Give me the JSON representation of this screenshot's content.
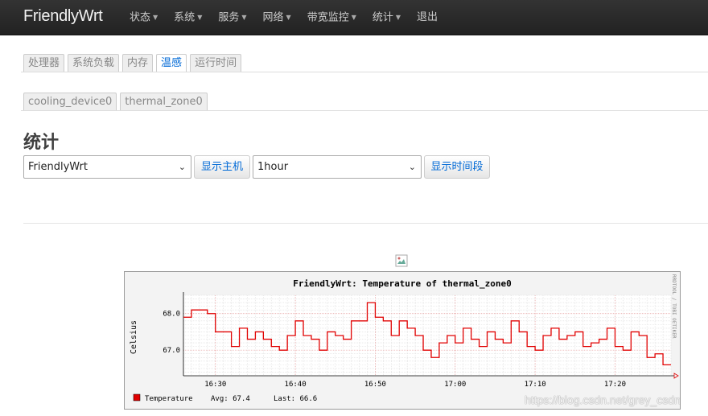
{
  "navbar": {
    "brand": "FriendlyWrt",
    "menu": [
      {
        "label": "状态",
        "dropdown": true
      },
      {
        "label": "系统",
        "dropdown": true
      },
      {
        "label": "服务",
        "dropdown": true
      },
      {
        "label": "网络",
        "dropdown": true
      },
      {
        "label": "带宽监控",
        "dropdown": true
      },
      {
        "label": "统计",
        "dropdown": true
      },
      {
        "label": "退出",
        "dropdown": false
      }
    ]
  },
  "tabs_primary": [
    {
      "label": "处理器",
      "active": false
    },
    {
      "label": "系统负载",
      "active": false
    },
    {
      "label": "内存",
      "active": false
    },
    {
      "label": "温感",
      "active": true
    },
    {
      "label": "运行时间",
      "active": false
    }
  ],
  "tabs_secondary": [
    {
      "label": "cooling_device0",
      "active": false
    },
    {
      "label": "thermal_zone0",
      "active": false
    }
  ],
  "page_title": "统计",
  "controls": {
    "host_select": "FriendlyWrt",
    "host_button": "显示主机",
    "timespan_select": "1hour",
    "timespan_button": "显示时间段"
  },
  "graph": {
    "title": "FriendlyWrt: Temperature of thermal_zone0",
    "ylabel": "Celsius",
    "side_text": "RRDTOOL / TOBI OETIKER",
    "legend": {
      "name": "Temperature",
      "avg": "Avg: 67.4",
      "last": "Last: 66.6",
      "color": "#e00000"
    }
  },
  "watermark": "https://blog.csdn.net/grey_csdn",
  "chart_data": {
    "type": "line",
    "title": "FriendlyWrt: Temperature of thermal_zone0",
    "xlabel": "",
    "ylabel": "Celsius",
    "x_ticks": [
      "16:30",
      "16:40",
      "16:50",
      "17:00",
      "17:10",
      "17:20"
    ],
    "y_ticks": [
      67.0,
      68.0
    ],
    "ylim": [
      66.3,
      68.5
    ],
    "grid": true,
    "series": [
      {
        "name": "Temperature",
        "color": "#e00000",
        "x_minutes_from_1630": [
          -4,
          -3,
          -2,
          -1,
          0,
          1,
          2,
          3,
          4,
          5,
          6,
          7,
          8,
          9,
          10,
          11,
          12,
          13,
          14,
          15,
          16,
          17,
          18,
          19,
          20,
          21,
          22,
          23,
          24,
          25,
          26,
          27,
          28,
          29,
          30,
          31,
          32,
          33,
          34,
          35,
          36,
          37,
          38,
          39,
          40,
          41,
          42,
          43,
          44,
          45,
          46,
          47,
          48,
          49,
          50,
          51,
          52,
          53,
          54,
          55,
          56
        ],
        "values": [
          67.9,
          68.1,
          68.1,
          68.0,
          67.5,
          67.5,
          67.1,
          67.6,
          67.3,
          67.5,
          67.3,
          67.1,
          67.0,
          67.4,
          67.8,
          67.4,
          67.3,
          67.0,
          67.5,
          67.4,
          67.3,
          67.8,
          67.8,
          68.3,
          67.9,
          67.8,
          67.4,
          67.8,
          67.6,
          67.4,
          67.0,
          66.8,
          67.2,
          67.4,
          67.2,
          67.6,
          67.3,
          67.1,
          67.5,
          67.3,
          67.2,
          67.8,
          67.5,
          67.1,
          67.0,
          67.4,
          67.6,
          67.3,
          67.4,
          67.5,
          67.1,
          67.2,
          67.3,
          67.6,
          67.1,
          67.0,
          67.5,
          67.4,
          66.8,
          66.9,
          66.6
        ]
      }
    ]
  }
}
